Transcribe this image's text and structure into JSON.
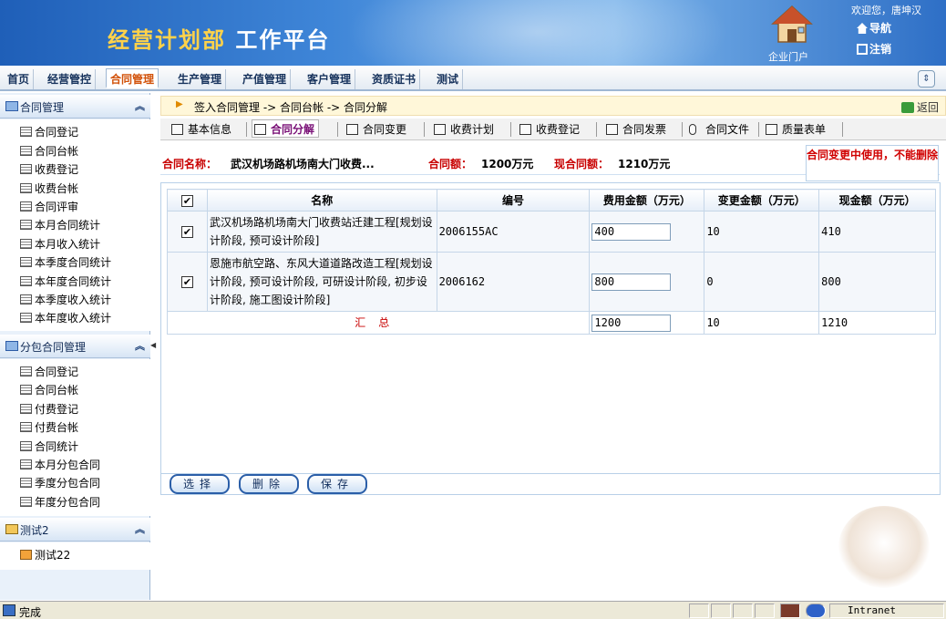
{
  "header": {
    "title_part1": "经营计划部",
    "title_part2": "工作平台",
    "portal_label": "企业门户",
    "welcome": "欢迎您，唐坤汉",
    "nav_label": "导航",
    "logout_label": "注销"
  },
  "menu": {
    "items": [
      {
        "label": "首页"
      },
      {
        "label": "经营管控"
      },
      {
        "label": "合同管理"
      },
      {
        "label": "生产管理"
      },
      {
        "label": "产值管理"
      },
      {
        "label": "客户管理"
      },
      {
        "label": "资质证书"
      },
      {
        "label": "测试"
      }
    ],
    "active": "合同管理"
  },
  "sidebar": {
    "sections": [
      {
        "title": "合同管理",
        "items": [
          "合同登记",
          "合同台帐",
          "收费登记",
          "收费台帐",
          "合同评审",
          "本月合同统计",
          "本月收入统计",
          "本季度合同统计",
          "本年度合同统计",
          "本季度收入统计",
          "本年度收入统计"
        ]
      },
      {
        "title": "分包合同管理",
        "items": [
          "合同登记",
          "合同台帐",
          "付费登记",
          "付费台帐",
          "合同统计",
          "本月分包合同",
          "季度分包合同",
          "年度分包合同"
        ]
      },
      {
        "title": "测试2",
        "items": [
          "测试22"
        ]
      }
    ]
  },
  "breadcrumb": {
    "text": "签入合同管理 -> 合同台帐 -> 合同分解",
    "back_label": "返回"
  },
  "tabs": [
    {
      "label": "基本信息"
    },
    {
      "label": "合同分解"
    },
    {
      "label": "合同变更"
    },
    {
      "label": "收费计划"
    },
    {
      "label": "收费登记"
    },
    {
      "label": "合同发票"
    },
    {
      "label": "合同文件"
    },
    {
      "label": "质量表单"
    }
  ],
  "contract": {
    "name_label": "合同名称：",
    "name_value": "武汉机场路机场南大门收费...",
    "amount_label": "合同额：",
    "amount_value": "1200万元",
    "current_label": "现合同额：",
    "current_value": "1210万元",
    "warning": "合同变更中使用，不能删除"
  },
  "table": {
    "headers": [
      "名称",
      "编号",
      "费用金额（万元）",
      "变更金额（万元）",
      "现金额（万元）"
    ],
    "rows": [
      {
        "checked": "✔",
        "name": "武汉机场路机场南大门收费站迁建工程[规划设计阶段, 预可设计阶段]",
        "code": "2006155AC",
        "fee": "400",
        "change": "10",
        "current": "410"
      },
      {
        "checked": "✔",
        "name": "恩施市航空路、东风大道道路改造工程[规划设计阶段, 预可设计阶段, 可研设计阶段, 初步设计阶段, 施工图设计阶段]",
        "code": "2006162",
        "fee": "800",
        "change": "0",
        "current": "800"
      }
    ],
    "header_check": "✔",
    "total": {
      "label": "汇总",
      "fee": "1200",
      "change": "10",
      "current": "1210"
    }
  },
  "buttons": {
    "select": "选择",
    "delete": "删除",
    "save": "保存"
  },
  "status": {
    "text": "完成",
    "zone": "Intranet"
  }
}
